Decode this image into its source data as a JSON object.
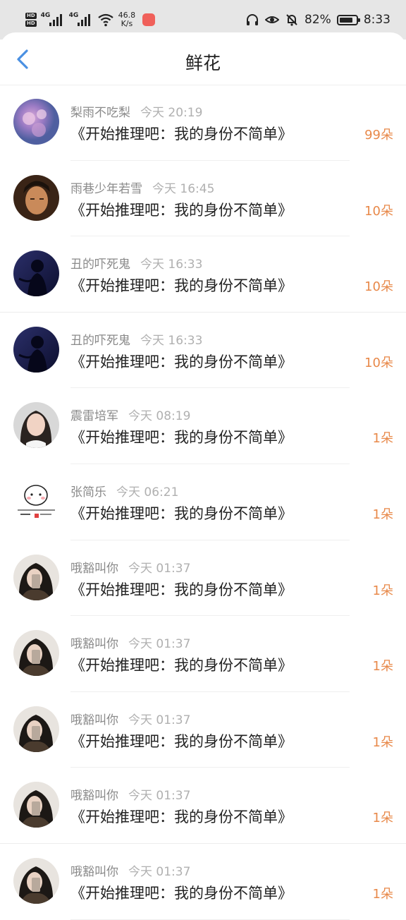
{
  "status_bar": {
    "network_label": "4G",
    "network_label2": "4G",
    "speed_value": "46.8",
    "speed_unit": "K/s",
    "battery_pct": "82%",
    "battery_level": 0.82,
    "time": "8:33"
  },
  "header": {
    "title": "鲜花"
  },
  "entries": [
    {
      "name": "梨雨不吃梨",
      "time": "今天 20:19",
      "book": "《开始推理吧：我的身份不简单》",
      "count": "99朵",
      "avatar": "flowers"
    },
    {
      "name": "雨巷少年若雪",
      "time": "今天 16:45",
      "book": "《开始推理吧：我的身份不简单》",
      "count": "10朵",
      "avatar": "man"
    },
    {
      "name": "丑的吓死鬼",
      "time": "今天 16:33",
      "book": "《开始推理吧：我的身份不简单》",
      "count": "10朵",
      "avatar": "silhouette"
    },
    {
      "name": "丑的吓死鬼",
      "time": "今天 16:33",
      "book": "《开始推理吧：我的身份不简单》",
      "count": "10朵",
      "avatar": "silhouette"
    },
    {
      "name": "震雷培军",
      "time": "今天 08:19",
      "book": "《开始推理吧：我的身份不简单》",
      "count": "1朵",
      "avatar": "woman"
    },
    {
      "name": "张简乐",
      "time": "今天 06:21",
      "book": "《开始推理吧：我的身份不简单》",
      "count": "1朵",
      "avatar": "cartoon"
    },
    {
      "name": "哦豁叫你",
      "time": "今天 01:37",
      "book": "《开始推理吧：我的身份不简单》",
      "count": "1朵",
      "avatar": "selfie"
    },
    {
      "name": "哦豁叫你",
      "time": "今天 01:37",
      "book": "《开始推理吧：我的身份不简单》",
      "count": "1朵",
      "avatar": "selfie"
    },
    {
      "name": "哦豁叫你",
      "time": "今天 01:37",
      "book": "《开始推理吧：我的身份不简单》",
      "count": "1朵",
      "avatar": "selfie"
    },
    {
      "name": "哦豁叫你",
      "time": "今天 01:37",
      "book": "《开始推理吧：我的身份不简单》",
      "count": "1朵",
      "avatar": "selfie"
    },
    {
      "name": "哦豁叫你",
      "time": "今天 01:37",
      "book": "《开始推理吧：我的身份不简单》",
      "count": "1朵",
      "avatar": "selfie"
    }
  ],
  "colors": {
    "accent": "#4a90e2",
    "count": "#e8894a",
    "status_bg": "#e6e6e6"
  }
}
